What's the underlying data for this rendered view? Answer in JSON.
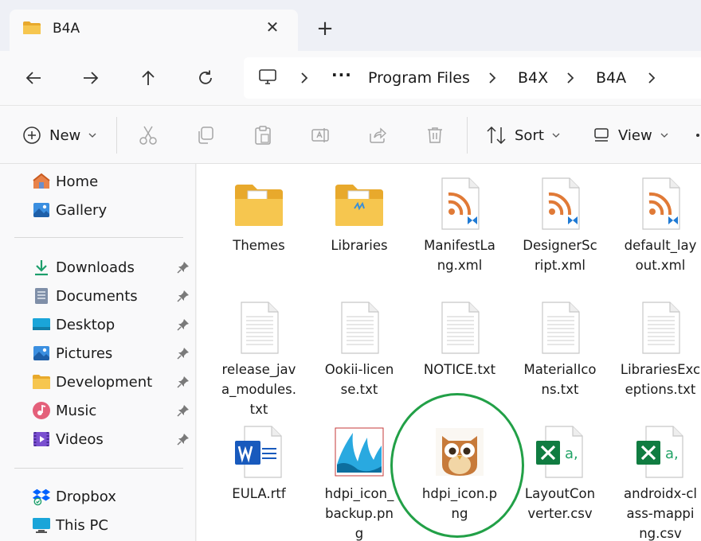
{
  "window": {
    "tab_title": "B4A",
    "tab_close_glyph": "✕",
    "new_tab_glyph": "+"
  },
  "address": {
    "more_glyph": "···",
    "crumbs": [
      "Program Files",
      "B4X",
      "B4A"
    ]
  },
  "commands": {
    "new_label": "New",
    "sort_label": "Sort",
    "view_label": "View"
  },
  "nav": {
    "top": [
      {
        "label": "Home",
        "icon": "home-icon"
      },
      {
        "label": "Gallery",
        "icon": "gallery-icon"
      }
    ],
    "quick": [
      {
        "label": "Downloads",
        "icon": "downloads-icon",
        "pinned": true
      },
      {
        "label": "Documents",
        "icon": "documents-icon",
        "pinned": true
      },
      {
        "label": "Desktop",
        "icon": "desktop-icon",
        "pinned": true
      },
      {
        "label": "Pictures",
        "icon": "pictures-icon",
        "pinned": true
      },
      {
        "label": "Development",
        "icon": "folder-icon",
        "pinned": true
      },
      {
        "label": "Music",
        "icon": "music-icon",
        "pinned": true
      },
      {
        "label": "Videos",
        "icon": "videos-icon",
        "pinned": true
      }
    ],
    "bottom": [
      {
        "label": "Dropbox",
        "icon": "dropbox-icon"
      },
      {
        "label": "This PC",
        "icon": "this-pc-icon"
      }
    ]
  },
  "files": [
    {
      "name": "Themes",
      "icon": "folder-icon"
    },
    {
      "name": "Libraries",
      "icon": "folder-icon"
    },
    {
      "name": "ManifestLa\nng.xml",
      "icon": "xml-icon"
    },
    {
      "name": "DesignerSc\nript.xml",
      "icon": "xml-icon"
    },
    {
      "name": "default_lay\nout.xml",
      "icon": "xml-icon"
    },
    {
      "name": "release_jav\na_modules.\ntxt",
      "icon": "text-file-icon"
    },
    {
      "name": "Ookii-licen\nse.txt",
      "icon": "text-file-icon"
    },
    {
      "name": "NOTICE.txt",
      "icon": "text-file-icon"
    },
    {
      "name": "MaterialIco\nns.txt",
      "icon": "text-file-icon"
    },
    {
      "name": "LibrariesExc\neptions.txt",
      "icon": "text-file-icon"
    },
    {
      "name": "EULA.rtf",
      "icon": "word-icon"
    },
    {
      "name": "hdpi_icon_\nbackup.pn\ng",
      "icon": "image-icon"
    },
    {
      "name": "hdpi_icon.p\nng",
      "icon": "owl-image-icon"
    },
    {
      "name": "LayoutCon\nverter.csv",
      "icon": "excel-csv-icon"
    },
    {
      "name": "androidx-cl\nass-mappi\nng.csv",
      "icon": "excel-csv-icon"
    }
  ],
  "colors": {
    "accent": "#0067c0",
    "folder": "#f4c04d",
    "rss": "#e07a37",
    "excel": "#107c41",
    "word": "#185abd",
    "highlight_circle": "#22a047"
  }
}
